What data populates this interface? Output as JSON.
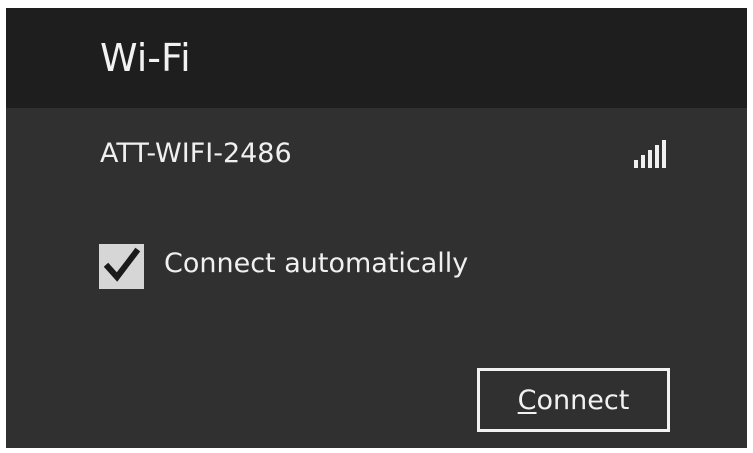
{
  "window": {
    "title": "Wi-Fi"
  },
  "network": {
    "name": "ATT-WIFI-2486",
    "signal_icon": "wifi-signal-bars-icon",
    "signal_bars": 5,
    "signal_bars_total": 5
  },
  "auto_connect": {
    "label": "Connect automatically",
    "checked": true,
    "check_icon": "checkmark-icon"
  },
  "connect_button": {
    "accel_key": "C",
    "label_rest": "onnect"
  },
  "colors": {
    "header_background": "#1e1e1e",
    "panel_background": "#303030",
    "text": "#f0f0f0",
    "checkbox_fill": "#d6d6d6",
    "checkmark": "#1a1a1a",
    "button_border": "#f2f2f2"
  }
}
